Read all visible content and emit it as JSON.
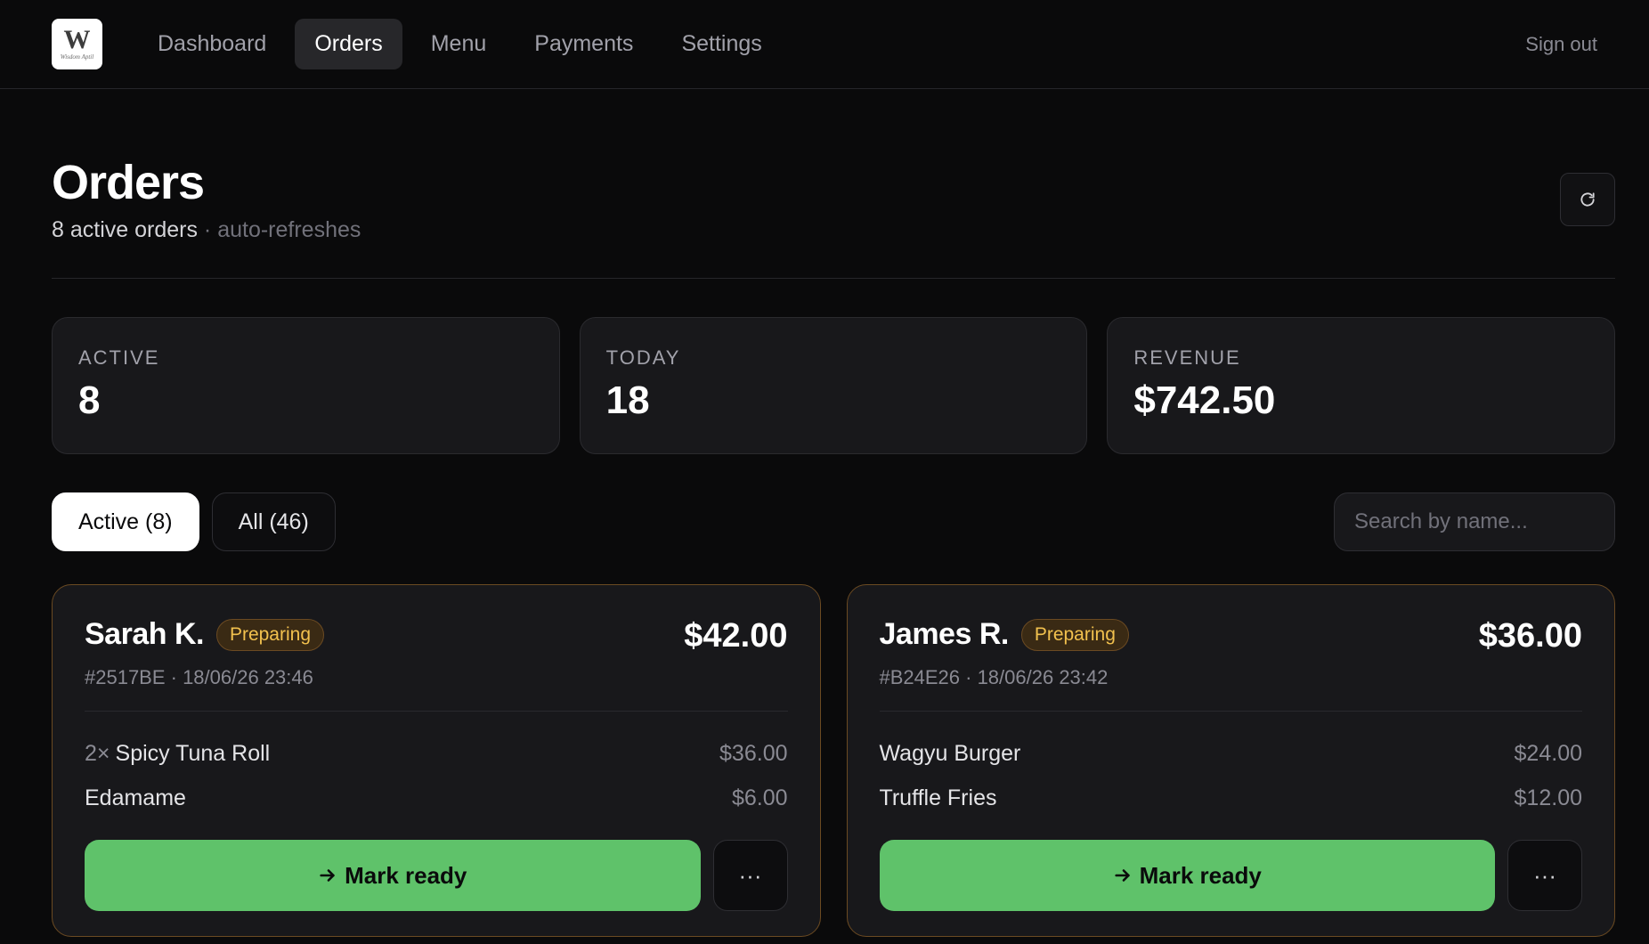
{
  "nav": {
    "logo": {
      "glyph": "W",
      "script": "Wisdom Aptil"
    },
    "items": [
      {
        "label": "Dashboard",
        "active": false
      },
      {
        "label": "Orders",
        "active": true
      },
      {
        "label": "Menu",
        "active": false
      },
      {
        "label": "Payments",
        "active": false
      },
      {
        "label": "Settings",
        "active": false
      }
    ],
    "signout_label": "Sign out"
  },
  "header": {
    "title": "Orders",
    "active_count_text": "8 active orders",
    "separator": "·",
    "auto_refresh_text": "auto-refreshes",
    "refresh_icon": "refresh-icon"
  },
  "stats": [
    {
      "label": "ACTIVE",
      "value": "8"
    },
    {
      "label": "TODAY",
      "value": "18"
    },
    {
      "label": "REVENUE",
      "value": "$742.50"
    }
  ],
  "filters": {
    "tabs": [
      {
        "label": "Active (8)",
        "active": true
      },
      {
        "label": "All (46)",
        "active": false
      }
    ],
    "search_placeholder": "Search by name..."
  },
  "orders": [
    {
      "customer": "Sarah K.",
      "status": "Preparing",
      "meta": "#2517BE · 18/06/26 23:46",
      "total": "$42.00",
      "items": [
        {
          "qty": "2×",
          "name": "Spicy Tuna Roll",
          "price": "$36.00"
        },
        {
          "qty": "",
          "name": "Edamame",
          "price": "$6.00"
        }
      ],
      "action_label": "Mark ready",
      "more_label": "···"
    },
    {
      "customer": "James R.",
      "status": "Preparing",
      "meta": "#B24E26 · 18/06/26 23:42",
      "total": "$36.00",
      "items": [
        {
          "qty": "",
          "name": "Wagyu Burger",
          "price": "$24.00"
        },
        {
          "qty": "",
          "name": "Truffle Fries",
          "price": "$12.00"
        }
      ],
      "action_label": "Mark ready",
      "more_label": "···"
    }
  ],
  "colors": {
    "background": "#0a0a0b",
    "card": "#18181b",
    "accent_green": "#5fc26a",
    "status_amber": "#f2c14e"
  }
}
